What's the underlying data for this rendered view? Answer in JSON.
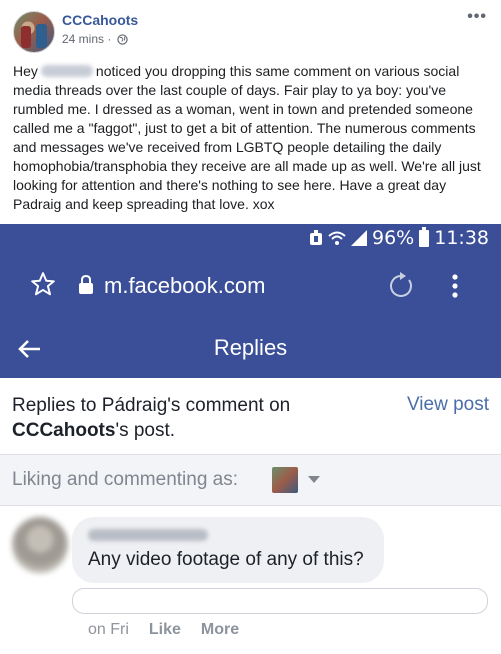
{
  "post": {
    "page_name": "CCCahoots",
    "time": "24 mins",
    "separator": "·",
    "more": "•••",
    "text_hey": "Hey",
    "text_body": "noticed you dropping this same comment on various social media threads over the last couple of days. Fair play to ya boy: you've rumbled me. I dressed as a woman, went in town and pretended someone called me a \"faggot\", just to get a bit of attention. The numerous comments and messages we've received from LGBTQ people detailing the daily homophobia/transphobia they receive are all made up as well. We're all just looking for attention and there's nothing to see here. Have a great day Padraig and keep spreading that love. xox"
  },
  "screenshot": {
    "status": {
      "battery": "96%",
      "clock": "11:38"
    },
    "browser": {
      "url": "m.facebook.com"
    },
    "nav": {
      "title": "Replies"
    },
    "replies_header": {
      "line1": "Replies to Pádraig's comment on",
      "line2_bold": "CCCahoots",
      "line2_rest": "'s post.",
      "view_post": "View post"
    },
    "liking": {
      "label": "Liking and commenting as:"
    },
    "comment": {
      "text": "Any video footage of any of this?",
      "time": "on Fri",
      "like": "Like",
      "more": "More"
    }
  },
  "colors": {
    "facebook_blue": "#3b4e98",
    "link_blue": "#385898"
  }
}
